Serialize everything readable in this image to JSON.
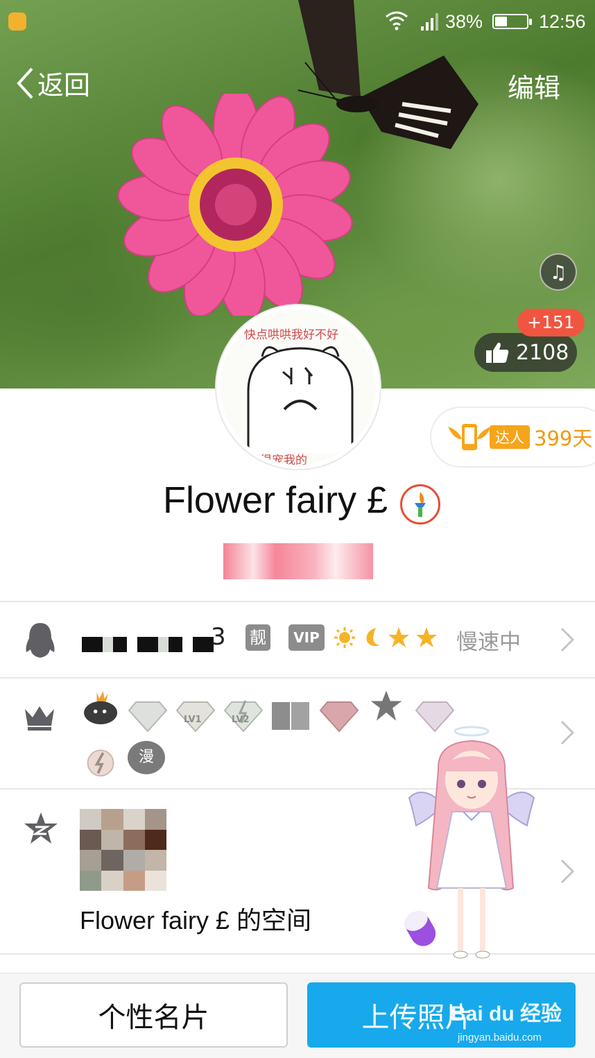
{
  "status_bar": {
    "battery_percent": "38%",
    "battery_level": 0.38,
    "time": "12:56"
  },
  "nav": {
    "back_label": "返回",
    "edit_label": "编辑"
  },
  "likes": {
    "new_count": "+151",
    "total": "2108"
  },
  "avatar": {
    "caption_top": "快点哄哄我好不好",
    "caption_bottom": "前很宠我的"
  },
  "talent": {
    "tag": "达人",
    "days": "399天"
  },
  "profile": {
    "name": "Flower fairy £"
  },
  "account_row": {
    "qq_number_tail": "3",
    "pretty_badge": "靓",
    "vip_badge": "VIP",
    "status": "慢速中"
  },
  "badges_row": {
    "gem_labels": [
      "LV1",
      "LV2"
    ],
    "manga_badge": "漫"
  },
  "qzone_row": {
    "title": "Flower fairy £ 的空间"
  },
  "buttons": {
    "card": "个性名片",
    "upload": "上传照片"
  },
  "watermark": {
    "brand": "Bai du 经验",
    "url": "jingyan.baidu.com"
  },
  "colors": {
    "accent_blue": "#17a9ec",
    "like_red": "#f05540",
    "talent_orange": "#f19a12"
  }
}
